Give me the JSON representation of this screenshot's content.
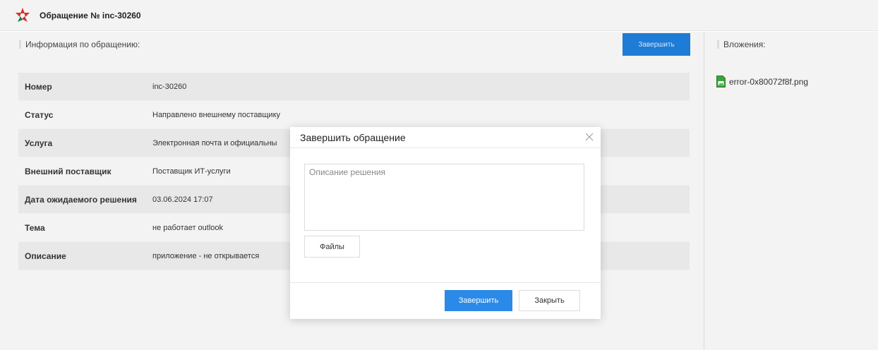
{
  "header": {
    "title": "Обращение № inc-30260"
  },
  "info_section": {
    "label": "Информация по обращению:",
    "complete_button": "Завершить",
    "rows": [
      {
        "label": "Номер",
        "value": "inc-30260"
      },
      {
        "label": "Статус",
        "value": "Направлено внешнему поставщику"
      },
      {
        "label": "Услуга",
        "value": "Электронная почта и официальны"
      },
      {
        "label": "Внешний поставщик",
        "value": "Поставщик ИТ-услуги"
      },
      {
        "label": "Дата ожидаемого решения",
        "value": "03.06.2024 17:07"
      },
      {
        "label": "Тема",
        "value": "не работает outlook"
      },
      {
        "label": "Описание",
        "value": "приложение - не открывается"
      }
    ]
  },
  "attachments": {
    "label": "Вложения:",
    "files": [
      {
        "name": "error-0x80072f8f.png",
        "icon": "image-file-icon"
      }
    ]
  },
  "modal": {
    "title": "Завершить обращение",
    "description_placeholder": "Описание решения",
    "description_value": "",
    "files_button": "Файлы",
    "complete_button": "Завершить",
    "close_button": "Закрыть"
  },
  "colors": {
    "accent": "#1e7bd6",
    "modal_accent": "#2b8ae8",
    "file_icon": "#3aa33a",
    "logo_red": "#d0342c"
  }
}
